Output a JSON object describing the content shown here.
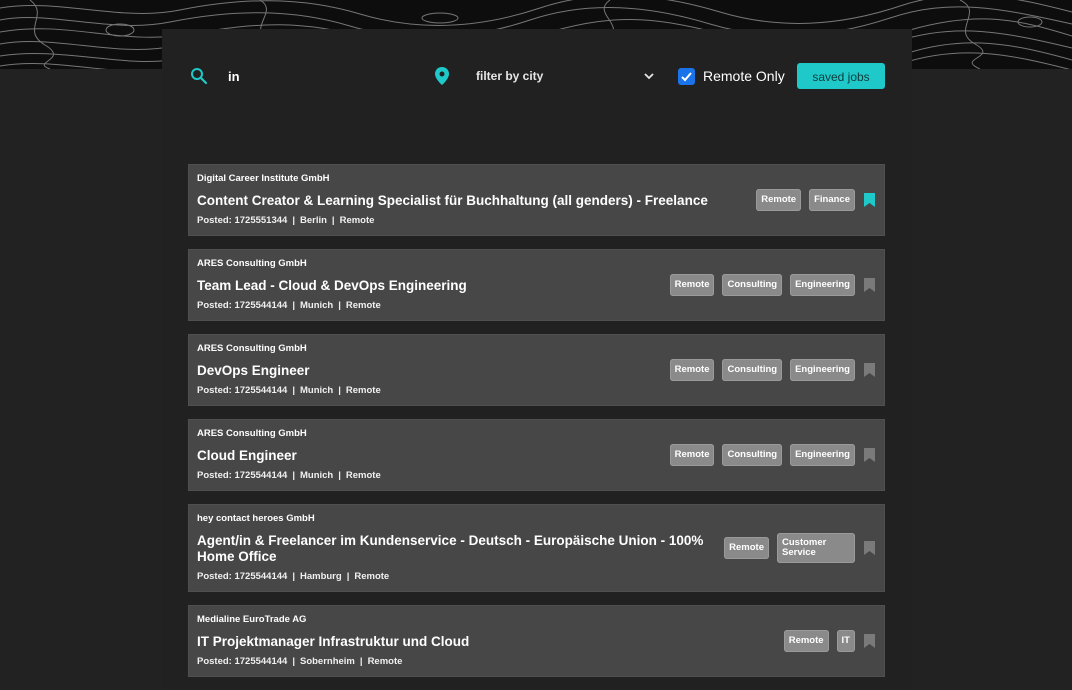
{
  "search": {
    "query": "in",
    "city_placeholder": "filter by city"
  },
  "filters": {
    "remote_only_label": "Remote Only",
    "remote_only_checked": true
  },
  "toolbar": {
    "saved_jobs_label": "saved jobs"
  },
  "colors": {
    "accent": "#1fc9c9",
    "card_bg": "#474747",
    "tag_bg": "#8a8a8a",
    "page_bg": "#222222",
    "checkbox": "#1a73e8"
  },
  "jobs": [
    {
      "company": "Digital Career Institute GmbH",
      "title": "Content Creator & Learning Specialist für Buchhaltung (all genders) - Freelance",
      "posted": "Posted: 1725551344",
      "city": "Berlin",
      "mode": "Remote",
      "tags": [
        "Remote",
        "Finance"
      ],
      "saved": true
    },
    {
      "company": "ARES Consulting GmbH",
      "title": "Team Lead - Cloud & DevOps Engineering",
      "posted": "Posted: 1725544144",
      "city": "Munich",
      "mode": "Remote",
      "tags": [
        "Remote",
        "Consulting",
        "Engineering"
      ],
      "saved": false
    },
    {
      "company": "ARES Consulting GmbH",
      "title": "DevOps Engineer",
      "posted": "Posted: 1725544144",
      "city": "Munich",
      "mode": "Remote",
      "tags": [
        "Remote",
        "Consulting",
        "Engineering"
      ],
      "saved": false
    },
    {
      "company": "ARES Consulting GmbH",
      "title": "Cloud Engineer",
      "posted": "Posted: 1725544144",
      "city": "Munich",
      "mode": "Remote",
      "tags": [
        "Remote",
        "Consulting",
        "Engineering"
      ],
      "saved": false
    },
    {
      "company": "hey contact heroes GmbH",
      "title": "Agent/in & Freelancer im Kundenservice - Deutsch - Europäische Union - 100% Home Office",
      "posted": "Posted: 1725544144",
      "city": "Hamburg",
      "mode": "Remote",
      "tags": [
        "Remote",
        "Customer Service"
      ],
      "saved": false
    },
    {
      "company": "Medialine EuroTrade AG",
      "title": "IT Projektmanager Infrastruktur und Cloud",
      "posted": "Posted: 1725544144",
      "city": "Sobernheim",
      "mode": "Remote",
      "tags": [
        "Remote",
        "IT"
      ],
      "saved": false
    }
  ]
}
